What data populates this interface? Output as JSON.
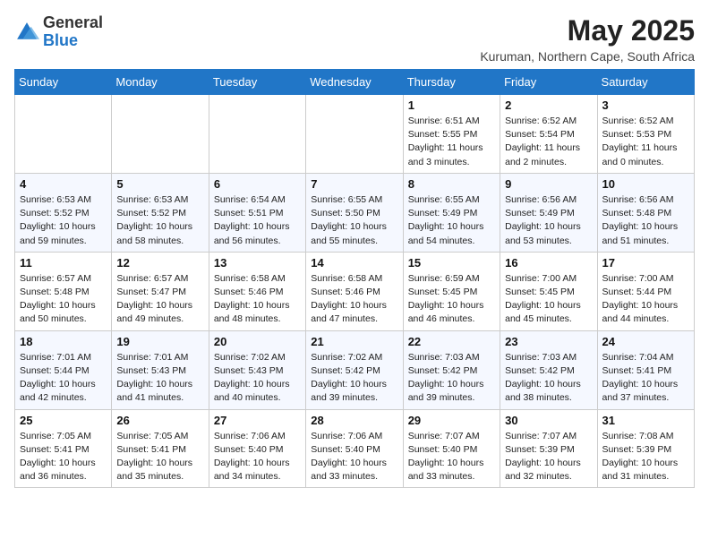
{
  "logo": {
    "general": "General",
    "blue": "Blue"
  },
  "title": "May 2025",
  "location": "Kuruman, Northern Cape, South Africa",
  "days_header": [
    "Sunday",
    "Monday",
    "Tuesday",
    "Wednesday",
    "Thursday",
    "Friday",
    "Saturday"
  ],
  "weeks": [
    [
      {
        "day": "",
        "info": ""
      },
      {
        "day": "",
        "info": ""
      },
      {
        "day": "",
        "info": ""
      },
      {
        "day": "",
        "info": ""
      },
      {
        "day": "1",
        "info": "Sunrise: 6:51 AM\nSunset: 5:55 PM\nDaylight: 11 hours\nand 3 minutes."
      },
      {
        "day": "2",
        "info": "Sunrise: 6:52 AM\nSunset: 5:54 PM\nDaylight: 11 hours\nand 2 minutes."
      },
      {
        "day": "3",
        "info": "Sunrise: 6:52 AM\nSunset: 5:53 PM\nDaylight: 11 hours\nand 0 minutes."
      }
    ],
    [
      {
        "day": "4",
        "info": "Sunrise: 6:53 AM\nSunset: 5:52 PM\nDaylight: 10 hours\nand 59 minutes."
      },
      {
        "day": "5",
        "info": "Sunrise: 6:53 AM\nSunset: 5:52 PM\nDaylight: 10 hours\nand 58 minutes."
      },
      {
        "day": "6",
        "info": "Sunrise: 6:54 AM\nSunset: 5:51 PM\nDaylight: 10 hours\nand 56 minutes."
      },
      {
        "day": "7",
        "info": "Sunrise: 6:55 AM\nSunset: 5:50 PM\nDaylight: 10 hours\nand 55 minutes."
      },
      {
        "day": "8",
        "info": "Sunrise: 6:55 AM\nSunset: 5:49 PM\nDaylight: 10 hours\nand 54 minutes."
      },
      {
        "day": "9",
        "info": "Sunrise: 6:56 AM\nSunset: 5:49 PM\nDaylight: 10 hours\nand 53 minutes."
      },
      {
        "day": "10",
        "info": "Sunrise: 6:56 AM\nSunset: 5:48 PM\nDaylight: 10 hours\nand 51 minutes."
      }
    ],
    [
      {
        "day": "11",
        "info": "Sunrise: 6:57 AM\nSunset: 5:48 PM\nDaylight: 10 hours\nand 50 minutes."
      },
      {
        "day": "12",
        "info": "Sunrise: 6:57 AM\nSunset: 5:47 PM\nDaylight: 10 hours\nand 49 minutes."
      },
      {
        "day": "13",
        "info": "Sunrise: 6:58 AM\nSunset: 5:46 PM\nDaylight: 10 hours\nand 48 minutes."
      },
      {
        "day": "14",
        "info": "Sunrise: 6:58 AM\nSunset: 5:46 PM\nDaylight: 10 hours\nand 47 minutes."
      },
      {
        "day": "15",
        "info": "Sunrise: 6:59 AM\nSunset: 5:45 PM\nDaylight: 10 hours\nand 46 minutes."
      },
      {
        "day": "16",
        "info": "Sunrise: 7:00 AM\nSunset: 5:45 PM\nDaylight: 10 hours\nand 45 minutes."
      },
      {
        "day": "17",
        "info": "Sunrise: 7:00 AM\nSunset: 5:44 PM\nDaylight: 10 hours\nand 44 minutes."
      }
    ],
    [
      {
        "day": "18",
        "info": "Sunrise: 7:01 AM\nSunset: 5:44 PM\nDaylight: 10 hours\nand 42 minutes."
      },
      {
        "day": "19",
        "info": "Sunrise: 7:01 AM\nSunset: 5:43 PM\nDaylight: 10 hours\nand 41 minutes."
      },
      {
        "day": "20",
        "info": "Sunrise: 7:02 AM\nSunset: 5:43 PM\nDaylight: 10 hours\nand 40 minutes."
      },
      {
        "day": "21",
        "info": "Sunrise: 7:02 AM\nSunset: 5:42 PM\nDaylight: 10 hours\nand 39 minutes."
      },
      {
        "day": "22",
        "info": "Sunrise: 7:03 AM\nSunset: 5:42 PM\nDaylight: 10 hours\nand 39 minutes."
      },
      {
        "day": "23",
        "info": "Sunrise: 7:03 AM\nSunset: 5:42 PM\nDaylight: 10 hours\nand 38 minutes."
      },
      {
        "day": "24",
        "info": "Sunrise: 7:04 AM\nSunset: 5:41 PM\nDaylight: 10 hours\nand 37 minutes."
      }
    ],
    [
      {
        "day": "25",
        "info": "Sunrise: 7:05 AM\nSunset: 5:41 PM\nDaylight: 10 hours\nand 36 minutes."
      },
      {
        "day": "26",
        "info": "Sunrise: 7:05 AM\nSunset: 5:41 PM\nDaylight: 10 hours\nand 35 minutes."
      },
      {
        "day": "27",
        "info": "Sunrise: 7:06 AM\nSunset: 5:40 PM\nDaylight: 10 hours\nand 34 minutes."
      },
      {
        "day": "28",
        "info": "Sunrise: 7:06 AM\nSunset: 5:40 PM\nDaylight: 10 hours\nand 33 minutes."
      },
      {
        "day": "29",
        "info": "Sunrise: 7:07 AM\nSunset: 5:40 PM\nDaylight: 10 hours\nand 33 minutes."
      },
      {
        "day": "30",
        "info": "Sunrise: 7:07 AM\nSunset: 5:39 PM\nDaylight: 10 hours\nand 32 minutes."
      },
      {
        "day": "31",
        "info": "Sunrise: 7:08 AM\nSunset: 5:39 PM\nDaylight: 10 hours\nand 31 minutes."
      }
    ]
  ]
}
